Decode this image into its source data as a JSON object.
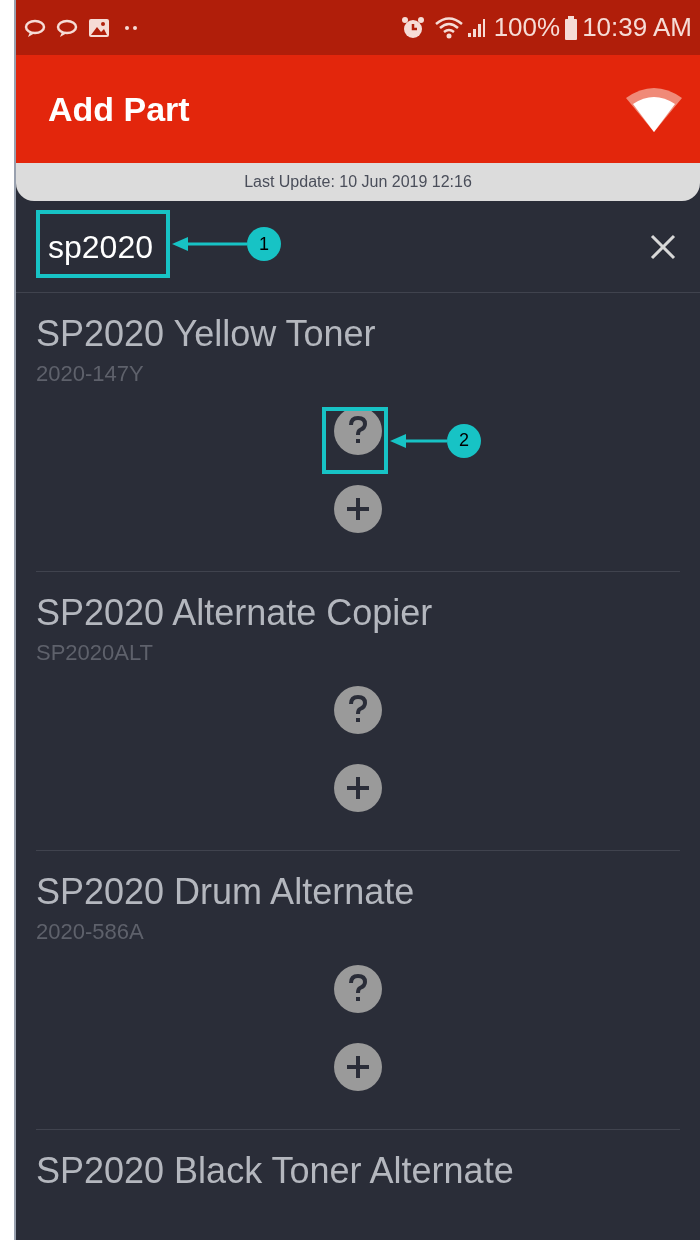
{
  "status_bar": {
    "battery": "100%",
    "time": "10:39 AM"
  },
  "app_bar": {
    "title": "Add Part"
  },
  "last_update": "Last Update: 10 Jun 2019 12:16",
  "search": {
    "value": "sp2020"
  },
  "parts": [
    {
      "name": "SP2020 Yellow Toner",
      "code": "2020-147Y"
    },
    {
      "name": "SP2020 Alternate Copier",
      "code": "SP2020ALT"
    },
    {
      "name": "SP2020 Drum Alternate",
      "code": "2020-586A"
    },
    {
      "name": "SP2020 Black Toner Alternate"
    }
  ],
  "callouts": [
    {
      "label": "1"
    },
    {
      "label": "2"
    }
  ]
}
